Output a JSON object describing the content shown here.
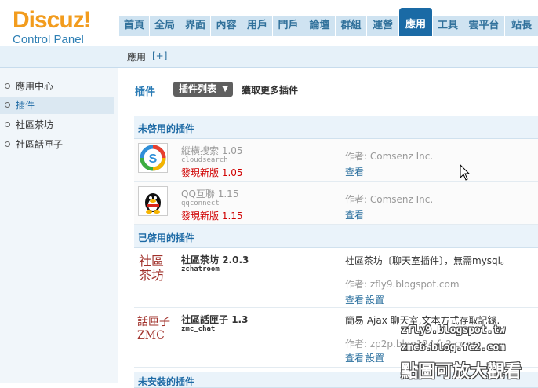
{
  "logo": {
    "title": "Discuz!",
    "subtitle": "Control Panel"
  },
  "topnav": {
    "tabs": [
      {
        "label": "首頁"
      },
      {
        "label": "全局"
      },
      {
        "label": "界面"
      },
      {
        "label": "內容"
      },
      {
        "label": "用戶"
      },
      {
        "label": "門戶"
      },
      {
        "label": "論壇"
      },
      {
        "label": "群組"
      },
      {
        "label": "運營"
      },
      {
        "label": "應用"
      },
      {
        "label": "工具"
      },
      {
        "label": "雲平台"
      },
      {
        "label": "站長"
      }
    ],
    "active": "應用"
  },
  "subbar": {
    "crumb": "應用",
    "plus": "[+]"
  },
  "sidebar": {
    "items": [
      {
        "label": "應用中心"
      },
      {
        "label": "插件"
      },
      {
        "label": "社區茶坊"
      },
      {
        "label": "社區話匣子"
      }
    ],
    "active": "插件"
  },
  "main": {
    "title": "插件",
    "list_button": "插件列表",
    "more_link": "獲取更多插件",
    "section_disabled": "未啓用的插件",
    "section_enabled": "已啓用的插件",
    "section_bottom": "未安裝的插件"
  },
  "plugins_disabled": [
    {
      "name": "縱橫搜索",
      "version": "1.05",
      "id": "cloudsearch",
      "update": "發現新版 1.05",
      "author": "作者: Comsenz Inc.",
      "action": "查看"
    },
    {
      "name": "QQ互聯",
      "version": "1.15",
      "id": "qqconnect",
      "update": "發現新版 1.15",
      "author": "作者: Comsenz Inc.",
      "action": "查看"
    }
  ],
  "plugins_enabled": [
    {
      "name": "社區茶坊",
      "version": "2.0.3",
      "id": "zchatroom",
      "icon_text_1": "社區",
      "icon_text_2": "茶坊",
      "desc": "社區茶坊〔聊天室插件〕，無需mysql。",
      "author": "作者: zfly9.blogspot.com",
      "action_view": "查看",
      "action_settings": "設置"
    },
    {
      "name": "社區話匣子",
      "version": "1.3",
      "id": "zmc_chat",
      "icon_text_1": "話匣子",
      "icon_text_2": "ZMC",
      "desc": "簡易 Ajax 聊天室,文本方式存取記錄.",
      "author": "作者: zp2p.blog124.fc2.com",
      "action_view": "查看",
      "action_settings": "設置"
    }
  ],
  "watermark": {
    "line1": "zfly9.blogspot.tw",
    "line2": "zmc6.blog.fc2.com",
    "caption": "點圖可放大觀看"
  },
  "colors": {
    "brand_orange": "#f29c1e",
    "nav_blue": "#1a6aa5",
    "update_red": "#d00000",
    "link_blue": "#2a6f9e"
  }
}
